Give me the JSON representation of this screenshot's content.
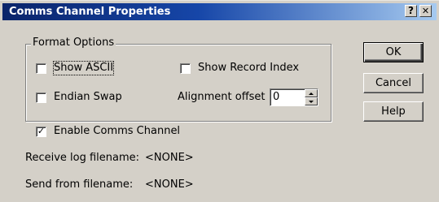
{
  "window": {
    "title": "Comms Channel Properties",
    "help_glyph": "?",
    "close_glyph": "✕"
  },
  "format_options": {
    "legend": "Format Options",
    "show_ascii": {
      "label": "Show ASCII",
      "checked": false
    },
    "show_record_index": {
      "label": "Show  Record Index",
      "checked": false
    },
    "endian_swap": {
      "label": "Endian Swap",
      "checked": false
    },
    "alignment_offset": {
      "label": "Alignment offset",
      "value": "0"
    }
  },
  "enable_comms": {
    "label": "Enable Comms Channel",
    "checked": true,
    "mark": "✓"
  },
  "receive_log": {
    "label": "Receive log filename:",
    "value": "<NONE>"
  },
  "send_from": {
    "label": "Send from filename:",
    "value": "<NONE>"
  },
  "buttons": {
    "ok": "OK",
    "cancel": "Cancel",
    "help": "Help"
  },
  "colors": {
    "titlebar_start": "#0a246a",
    "titlebar_end": "#a6caf0",
    "face": "#d4d0c8"
  }
}
